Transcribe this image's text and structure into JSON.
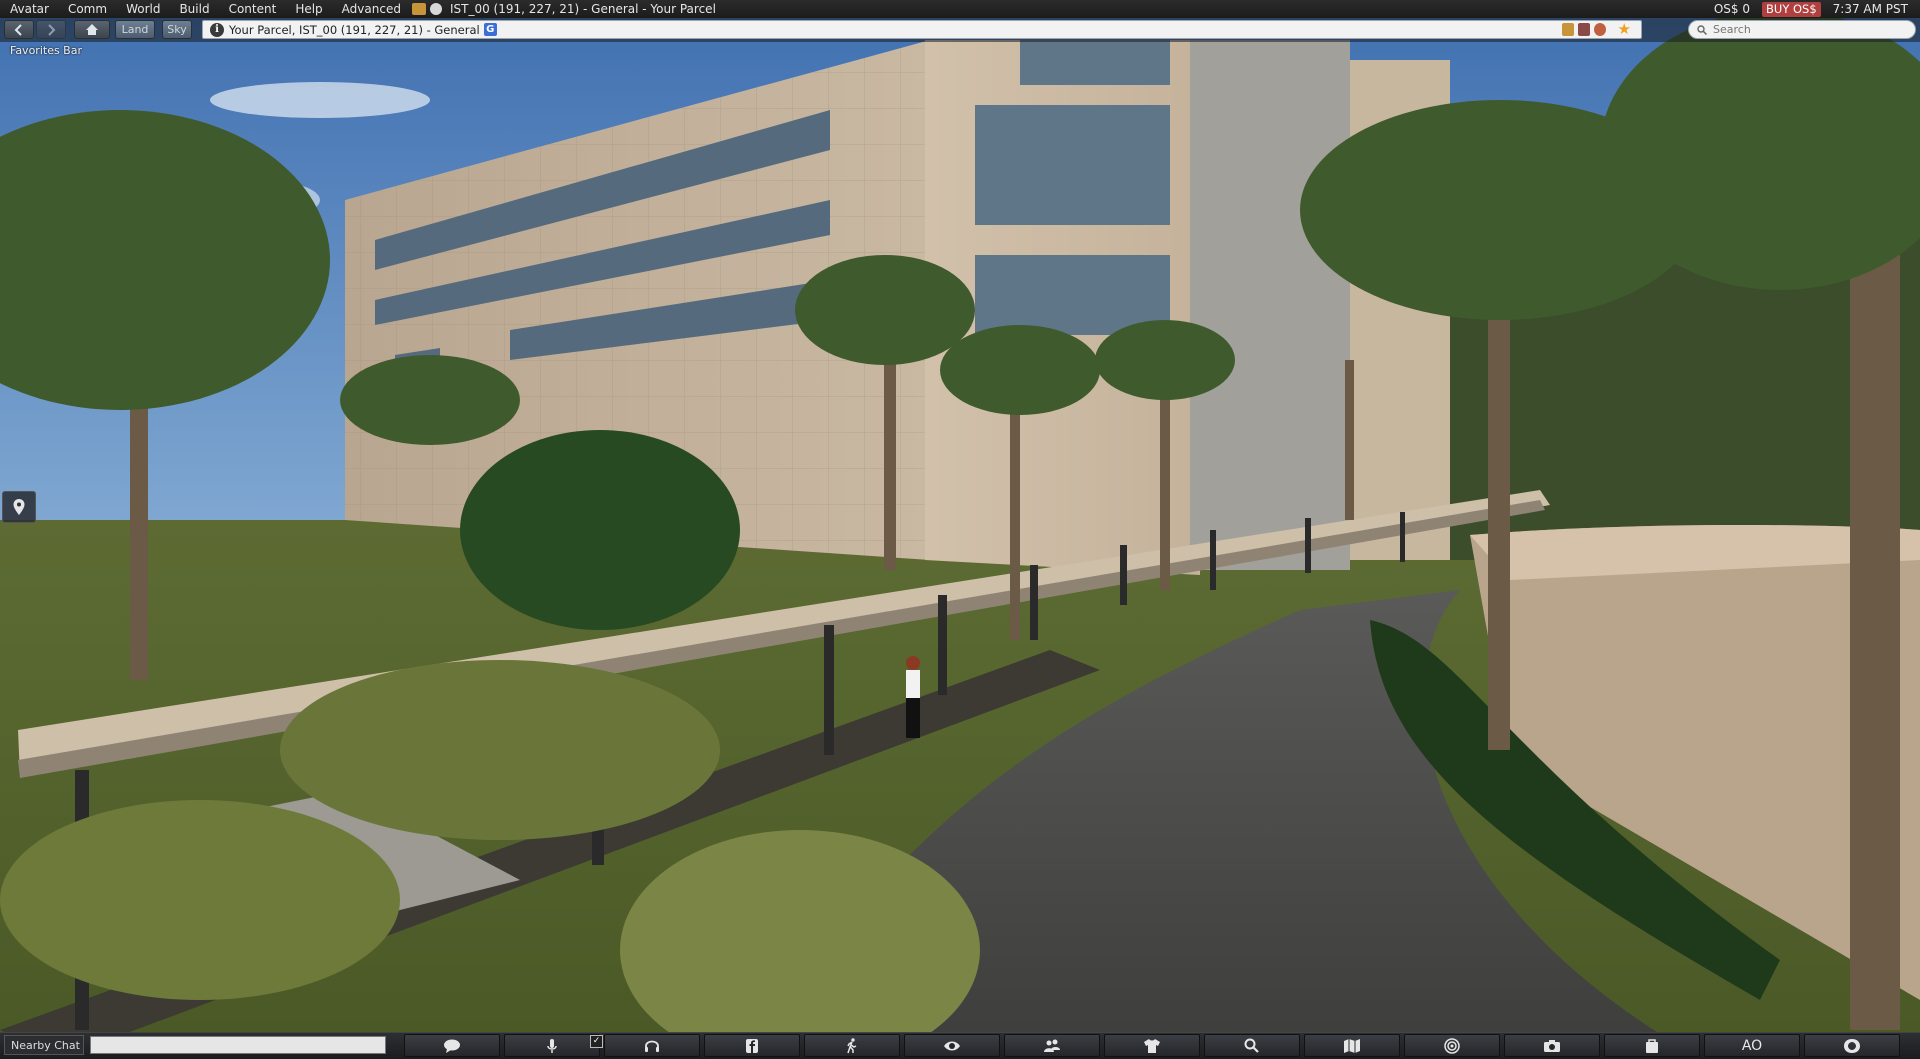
{
  "menu": {
    "items": [
      "Avatar",
      "Comm",
      "World",
      "Build",
      "Content",
      "Help",
      "Advanced"
    ],
    "title": "IST_00 (191, 227, 21) - General - Your Parcel",
    "balance": "OS$ 0",
    "buy_label": "BUY OS$",
    "clock": "7:37 AM PST"
  },
  "nav": {
    "land_label": "Land",
    "sky_label": "Sky",
    "location": "Your Parcel, IST_00 (191, 227, 21) - General",
    "location_badge": "G",
    "search_placeholder": "Search"
  },
  "favorites_bar": "Favorites Bar",
  "bottom": {
    "nearby_chat_label": "Nearby Chat",
    "chat_value": "",
    "ao_label": "AO",
    "toolbar_icons": [
      "speech-bubble-icon",
      "microphone-icon",
      "headphones-icon",
      "facebook-icon",
      "walk-icon",
      "eye-icon",
      "people-icon",
      "shirt-icon",
      "search-icon",
      "map-icon",
      "radar-icon",
      "camera-icon",
      "inventory-icon",
      "ao-icon",
      "viewer-icon"
    ]
  },
  "colors": {
    "menubar": "#1e1e1e",
    "buy_button": "#b04040",
    "favorite_star": "#f0a020",
    "g_badge": "#3b6fd6"
  }
}
